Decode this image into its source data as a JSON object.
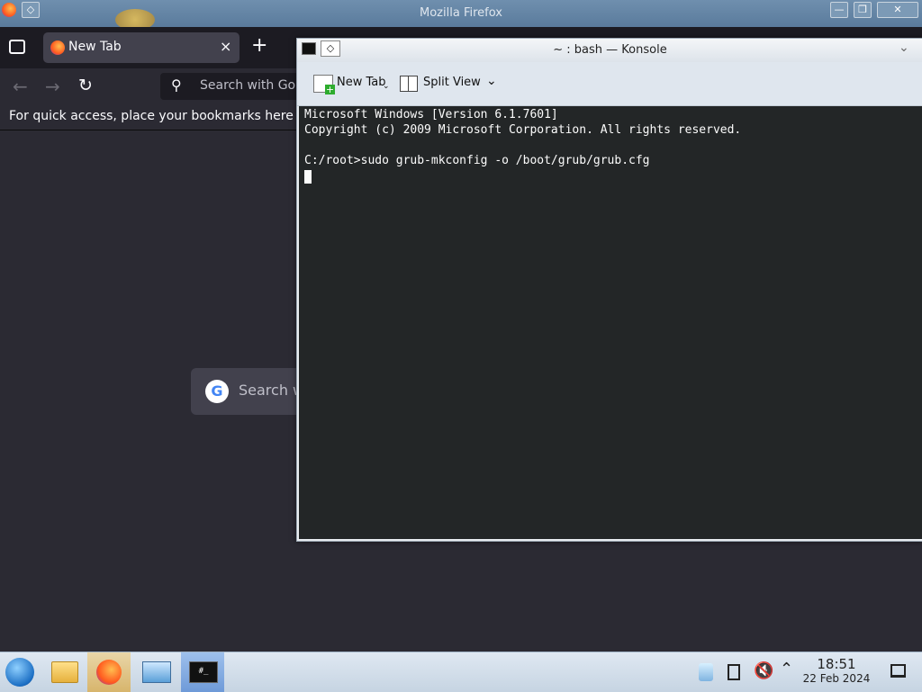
{
  "firefox": {
    "window_title": "Mozilla Firefox",
    "tab_title": "New Tab",
    "tab_close": "×",
    "new_tab": "+",
    "urlbar_placeholder": "Search with Go",
    "bookmarks_hint": "For quick access, place your bookmarks here on",
    "content_search": "Search w"
  },
  "konsole": {
    "title": "~ : bash — Konsole",
    "toolbar": {
      "new_tab": "New Tab",
      "split_view": "Split View"
    },
    "terminal_lines": [
      "Microsoft Windows [Version 6.1.7601]",
      "Copyright (c) 2009 Microsoft Corporation. All rights reserved.",
      "",
      "C:/root>sudo grub-mkconfig -o /boot/grub/grub.cfg"
    ]
  },
  "taskbar": {
    "time": "18:51",
    "date": "22 Feb 2024"
  },
  "colors": {
    "firefox_bg": "#2b2a33",
    "terminal_bg": "#232627",
    "taskbar_bg": "#c6d4e2"
  }
}
